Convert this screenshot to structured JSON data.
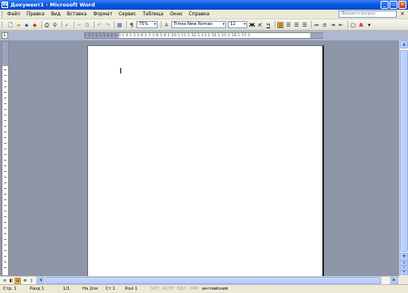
{
  "window": {
    "title": "Документ1 - Microsoft Word",
    "icon": "word-icon",
    "buttons": [
      "_",
      "▭",
      "✕"
    ]
  },
  "menu": {
    "items": [
      "Файл",
      "Правка",
      "Вид",
      "Вставка",
      "Формат",
      "Сервис",
      "Таблица",
      "Окно",
      "Справка"
    ],
    "help_placeholder": "Введите вопрос",
    "close_glyph": "×"
  },
  "toolbar": {
    "zoom": "75%",
    "font": "Times New Roman",
    "size": "12",
    "bold": "Ж",
    "italic": "К",
    "underline": "Ч",
    "font_color": "#d40000",
    "highlight_active": true
  },
  "ruler": {
    "corner_glyph": "L",
    "scale": "2·1·1·1·1·1·1·2·1·3·1·4·1·5·1·6·1·7·1·8·1·9·1·10·1·11·1·12·1·13·1·14·1·15·1·16·1·17·1"
  },
  "status": {
    "page": "Стр. 1",
    "section": "Разд 1",
    "pages": "1/1",
    "position": "На 2см",
    "line": "Ст 1",
    "column": "Кол 1",
    "rec": "ЗАП",
    "trk": "ИСПР",
    "ext": "ВДЛ",
    "ovr": "ЗАМ",
    "language": "английский"
  }
}
